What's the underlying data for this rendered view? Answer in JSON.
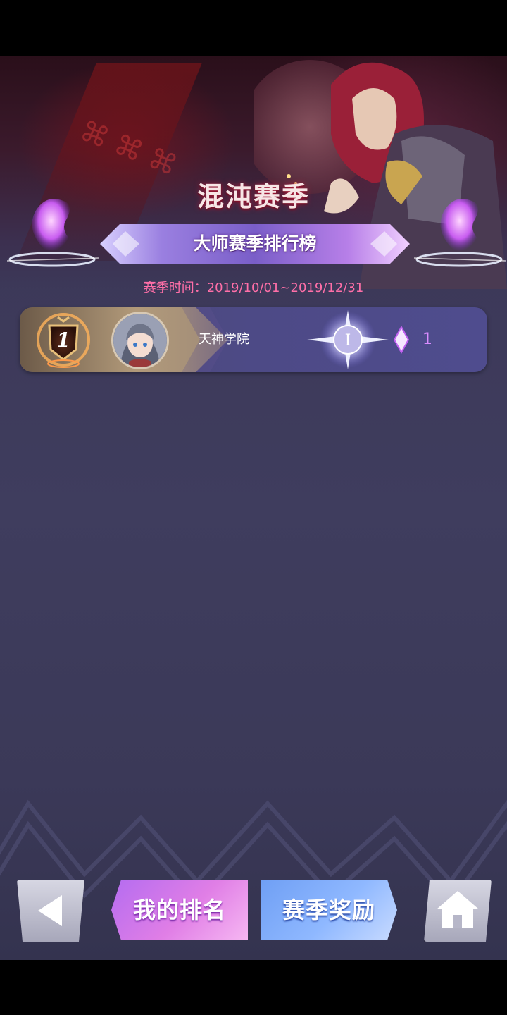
{
  "banner": {
    "season_title": "混沌赛季",
    "ribbon_label": "大师赛季排行榜",
    "season_time": "赛季时间：2019/10/01~2019/12/31"
  },
  "ranking": {
    "rows": [
      {
        "rank": "1",
        "player_name": "天神学院",
        "tier_numeral": "I",
        "diamond_count": "1"
      }
    ]
  },
  "buttons": {
    "my_rank": "我的排名",
    "season_reward": "赛季奖励"
  },
  "icons": {
    "back": "back-arrow-icon",
    "home": "home-icon",
    "diamond": "diamond-icon",
    "rank_badge": "rank-badge-icon",
    "rank_emblem": "rank-emblem-icon"
  },
  "colors": {
    "season_time": "#ff6fa8",
    "diamond_count": "#d98cff",
    "my_rank_button": "#d07ae8",
    "season_reward_button": "#8fb8ff"
  }
}
